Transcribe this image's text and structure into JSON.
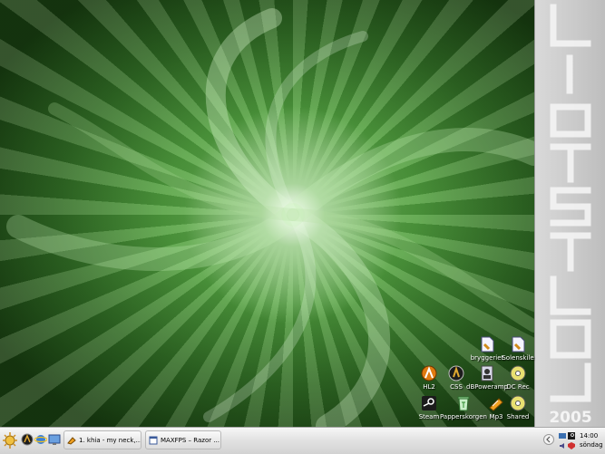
{
  "desktop": {
    "brand_text": "LiNOSTLöM",
    "brand_year": "2005",
    "icons": [
      {
        "label": "bryggeriet",
        "icon": "document-icon"
      },
      {
        "label": "Solenskile",
        "icon": "document-icon"
      },
      {
        "label": "HL2",
        "icon": "half-life-icon"
      },
      {
        "label": "CSS",
        "icon": "counter-strike-icon"
      },
      {
        "label": "dBPoweramp",
        "icon": "dbpoweramp-icon"
      },
      {
        "label": "DC Rec",
        "icon": "disc-icon"
      },
      {
        "label": "Steam",
        "icon": "steam-icon"
      },
      {
        "label": "Papperskorgen",
        "icon": "recycle-bin-icon"
      },
      {
        "label": "Mp3",
        "icon": "music-folder-icon"
      },
      {
        "label": "Shared",
        "icon": "disc-icon"
      }
    ]
  },
  "taskbar": {
    "tasks": [
      {
        "label": "1. khia - my neck,...",
        "icon": "winamp-icon"
      },
      {
        "label": "MAXFPS – Razor ...",
        "icon": "browser-window-icon"
      }
    ],
    "clock": {
      "time": "14:00",
      "day": "söndag"
    }
  },
  "colors": {
    "accent": "#7fbf6a",
    "brand_bar": "#cfcfcf",
    "taskbar": "#e3e3e3"
  }
}
